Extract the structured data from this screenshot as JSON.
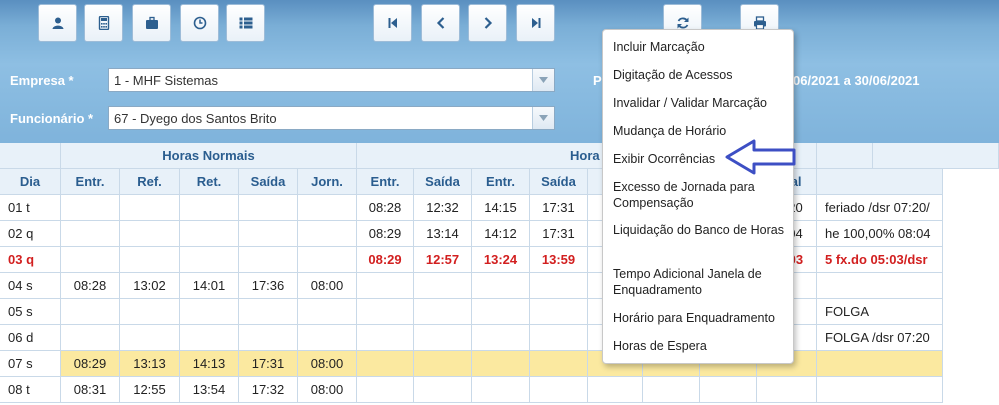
{
  "toolbar": {
    "left_icons": [
      "user-icon",
      "calculator-icon",
      "briefcase-icon",
      "clock-icon",
      "list-icon"
    ],
    "nav_icons": [
      "first-page-icon",
      "previous-icon",
      "next-icon",
      "last-page-icon"
    ],
    "right_icons": [
      "refresh-icon",
      "print-icon"
    ]
  },
  "filters": {
    "empresa_label": "Empresa *",
    "empresa_value": "1 - MHF Sistemas",
    "funcionario_label": "Funcionário *",
    "funcionario_value": "67 - Dyego dos Santos Brito",
    "periodo_label_visible": "P",
    "periodo_value_visible": "06/2021 a 30/06/2021"
  },
  "grid": {
    "groups": {
      "normais": "Horas Normais",
      "second": "Hora"
    },
    "columns": [
      "Dia",
      "Entr.",
      "Ref.",
      "Ret.",
      "Saída",
      "Jorn.",
      "Entr.",
      "Saída",
      "Entr.",
      "Saída",
      "",
      "",
      "a",
      "Total",
      ""
    ],
    "rows": [
      {
        "dia": "01 t",
        "cells": [
          "",
          "",
          "",
          "",
          "",
          "08:28",
          "12:32",
          "14:15",
          "17:31",
          "",
          "",
          "",
          "07:20",
          "feriado /dsr 07:20/"
        ],
        "style": ""
      },
      {
        "dia": "02 q",
        "cells": [
          "",
          "",
          "",
          "",
          "",
          "08:29",
          "13:14",
          "14:12",
          "17:31",
          "",
          "",
          "",
          "08:04",
          "he 100,00% 08:04"
        ],
        "style": ""
      },
      {
        "dia": "03 q",
        "cells": [
          "",
          "",
          "",
          "",
          "",
          "08:29",
          "12:57",
          "13:24",
          "13:59",
          "",
          "",
          "",
          "05:03",
          "5 fx.do 05:03/dsr"
        ],
        "style": "red"
      },
      {
        "dia": "04 s",
        "cells": [
          "08:28",
          "13:02",
          "14:01",
          "17:36",
          "08:00",
          "",
          "",
          "",
          "",
          "",
          "",
          "",
          "",
          ""
        ],
        "style": ""
      },
      {
        "dia": "05 s",
        "cells": [
          "",
          "",
          "",
          "",
          "",
          "",
          "",
          "",
          "",
          "",
          "",
          "",
          "",
          "FOLGA"
        ],
        "style": ""
      },
      {
        "dia": "06 d",
        "cells": [
          "",
          "",
          "",
          "",
          "",
          "",
          "",
          "",
          "",
          "",
          "",
          "",
          "",
          "FOLGA /dsr 07:20"
        ],
        "style": ""
      },
      {
        "dia": "07 s",
        "cells": [
          "08:29",
          "13:13",
          "14:13",
          "17:31",
          "08:00",
          "",
          "",
          "",
          "",
          "",
          "",
          "",
          "",
          ""
        ],
        "style": "highlight"
      },
      {
        "dia": "08 t",
        "cells": [
          "08:31",
          "12:55",
          "13:54",
          "17:32",
          "08:00",
          "",
          "",
          "",
          "",
          "",
          "",
          "",
          "",
          ""
        ],
        "style": ""
      }
    ]
  },
  "menu": {
    "items": [
      "Incluir Marcação",
      "Digitação de Acessos",
      "Invalidar / Validar Marcação",
      "Mudança de Horário",
      "Exibir Ocorrências",
      "Excesso de Jornada para Compensação",
      "Liquidação do Banco de Horas",
      "Tempo Adicional Janela de Enquadramento",
      "Horário para Enquadramento",
      "Horas de Espera"
    ]
  },
  "colors": {
    "header_blue": "#7fb3db",
    "grid_header_text": "#2a5d8f",
    "late_red": "#d21f1f",
    "highlight_row": "#fbe9a0",
    "pointer_arrow": "#3d4fc4"
  }
}
